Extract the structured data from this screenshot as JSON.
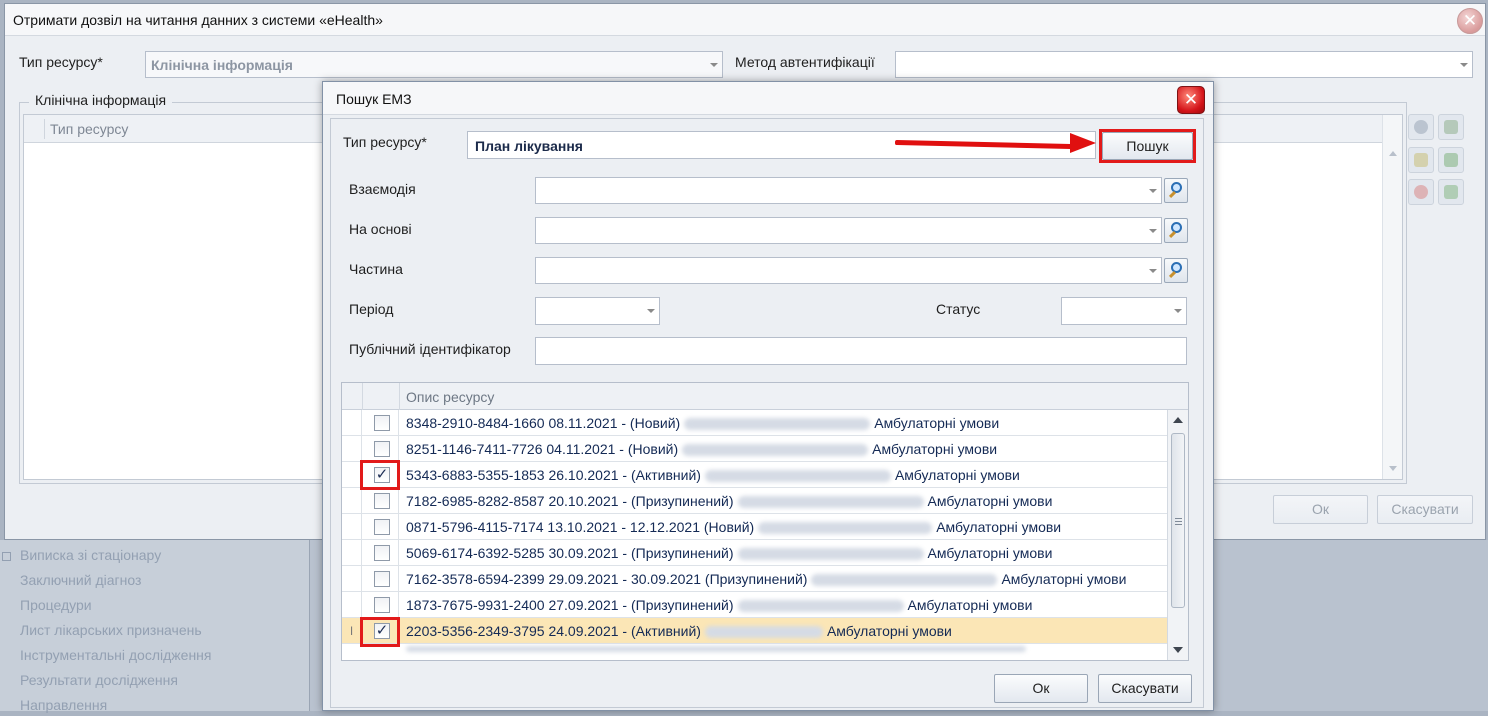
{
  "main_dialog": {
    "title": "Отримати дозвіл на читання данних з системи «eHealth»",
    "close_glyph": "✕",
    "resource_type_label": "Тип ресурсу*",
    "resource_type_value": "Клінічна інформація",
    "auth_method_label": "Метод автентифікації",
    "auth_method_value": "",
    "group_title": "Клінічна інформація",
    "grid_column": "Тип ресурсу",
    "ok_label": "Ок",
    "cancel_label": "Скасувати"
  },
  "background_nav": {
    "items": [
      "Виписка зі стаціонару",
      "Заключний діагноз",
      "Процедури",
      "Лист лікарських призначень",
      "Інструментальні дослідження",
      "Результати дослідження",
      "Направлення"
    ]
  },
  "search_modal": {
    "title": "Пошук ЕМЗ",
    "close_glyph": "✕",
    "resource_type_label": "Тип ресурсу*",
    "resource_type_value": "План лікування",
    "search_button": "Пошук",
    "interaction_label": "Взаємодія",
    "basis_label": "На основі",
    "part_label": "Частина",
    "period_label": "Період",
    "status_label": "Статус",
    "public_id_label": "Публічний ідентифікатор",
    "grid_header": "Опис ресурсу",
    "rows": [
      {
        "pre": "8348-2910-8484-1660 08.11.2021 -  (Новий)",
        "post": "Амбулаторні умови",
        "checked": false,
        "check": ""
      },
      {
        "pre": "8251-1146-7411-7726 04.11.2021 -  (Новий)",
        "post": "Амбулаторні умови",
        "checked": false,
        "check": ""
      },
      {
        "pre": "5343-6883-5355-1853 26.10.2021 -  (Активний)",
        "post": "Амбулаторні умови",
        "checked": true,
        "check": "✓"
      },
      {
        "pre": "7182-6985-8282-8587 20.10.2021 -  (Призупинений)",
        "post": "Амбулаторні умови",
        "checked": false,
        "check": ""
      },
      {
        "pre": "0871-5796-4115-7174 13.10.2021 - 12.12.2021 (Новий)",
        "post": "Амбулаторні умови",
        "checked": false,
        "check": ""
      },
      {
        "pre": "5069-6174-6392-5285 30.09.2021 -  (Призупинений)",
        "post": "Амбулаторні умови",
        "checked": false,
        "check": ""
      },
      {
        "pre": "7162-3578-6594-2399 29.09.2021 - 30.09.2021 (Призупинений)",
        "post": "Амбулаторні умови",
        "checked": false,
        "check": ""
      },
      {
        "pre": "1873-7675-9931-2400 27.09.2021 -  (Призупинений)",
        "post": "Амбулаторні умови",
        "checked": false,
        "check": ""
      },
      {
        "pre": "2203-5356-2349-3795 24.09.2021 -  (Активний)",
        "post": "Амбулаторні умови",
        "checked": true,
        "check": "✓",
        "selected": true,
        "indicator": "I"
      }
    ],
    "ok_label": "Ок",
    "cancel_label": "Скасувати"
  },
  "colors": {
    "annotation_red": "#e21a1a",
    "selected_row": "#fbe6b6",
    "row_text": "#142a55"
  }
}
